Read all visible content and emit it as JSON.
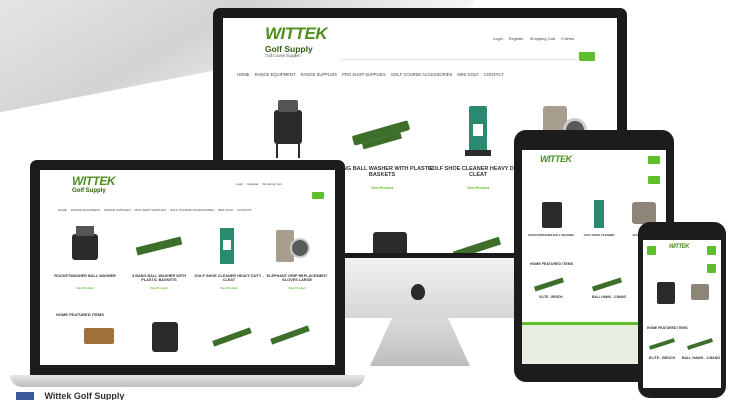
{
  "brand": {
    "name": "WITTEK",
    "sub": "Golf Supply",
    "tagline": "Golf Course Supplies"
  },
  "imac": {
    "header_links": [
      "Login",
      "Register",
      "Shopping Cart",
      "0 items"
    ],
    "nav": [
      "HOME",
      "RANGE EQUIPMENT",
      "RANGE SUPPLIES",
      "PRO SHOP SUPPLIES",
      "GOLF COURSE ACCESSORIES",
      "MINI GOLF",
      "CONTACT"
    ],
    "products": [
      {
        "label": "3 BANG BALL WASHER WITH PLASTIC BASKETS",
        "link": "View Product"
      },
      {
        "label": "GOLF SHOE CLEANER HEAVY DUTY - CLEAT",
        "link": "View Product"
      }
    ]
  },
  "laptop": {
    "header_links": [
      "Login",
      "Register",
      "Shopping Cart"
    ],
    "nav": [
      "HOME",
      "RANGE EQUIPMENT",
      "RANGE SUPPLIES",
      "PRO SHOP SUPPLIES",
      "GOLF COURSE ACCESSORIES",
      "MINI GOLF",
      "CONTACT"
    ],
    "products": [
      {
        "label": "ROCKETWASHER BALL WASHER",
        "link": "View Product"
      },
      {
        "label": "3 BANG BALL WASHER WITH PLASTIC BASKETS",
        "link": "View Product"
      },
      {
        "label": "GOLF SHOE CLEANER HEAVY DUTY - CLEAT",
        "link": "View Product"
      },
      {
        "label": "ELEPHANT GRIP REPLACEMENT GLOVES LARGE",
        "link": "View Product"
      }
    ],
    "section": "HOME FEATURED ITEMS"
  },
  "tablet": {
    "products": [
      "ROCKETWASHER BALL WASHER",
      "GOLF SHOE CLEANER",
      "ELEPHANT GRIP"
    ],
    "section": "HOME FEATURED ITEMS",
    "features": [
      "ELITE - BENCH",
      "BALL HAWK - 3 BANG"
    ]
  },
  "phone": {
    "section": "HOME FEATURED ITEMS",
    "features": [
      "ELITE - BENCH",
      "BALL HAWK - 3 BANG"
    ]
  },
  "bottom_text": "Wittek Golf Supply",
  "colors": {
    "accent": "#5fbf2b",
    "dark_green": "#2f5d11",
    "frame": "#1e1e1e",
    "silver": "#d9d9d9"
  }
}
